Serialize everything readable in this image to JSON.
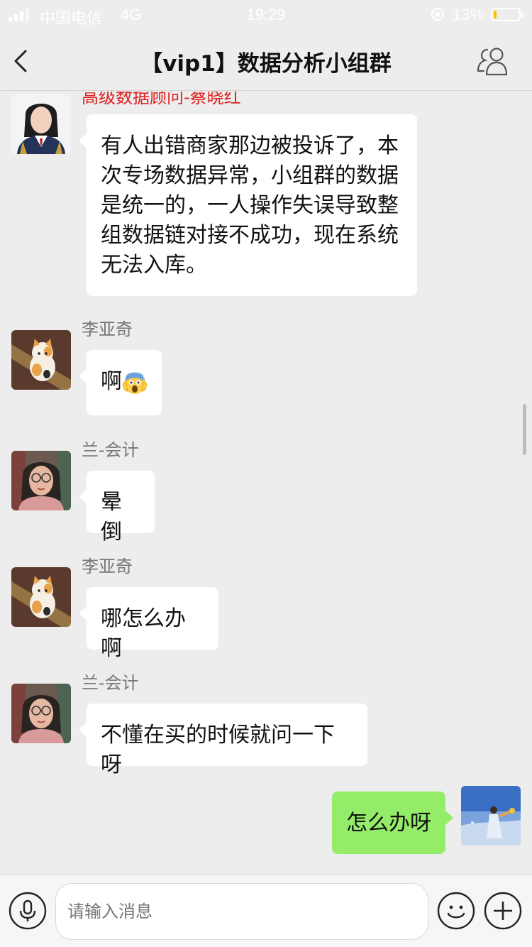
{
  "status_bar": {
    "carrier": "中国电信",
    "network": "4G",
    "time": "19:29",
    "battery_percent": "13%",
    "battery_level": 0.13
  },
  "nav": {
    "title": "【vip1】数据分析小组群",
    "icons": [
      "back-arrow-icon",
      "group-members-icon"
    ]
  },
  "messages": [
    {
      "sender": "高级数据顾问-蔡晓红",
      "sender_color": "#e02020",
      "text": "有人出错商家那边被投诉了，本\n次专场数据异常，小组群的数据\n是统一的，一人操作失误导致整\n组数据链对接不成功，现在系统\n无法入库。"
    },
    {
      "sender": "李亚奇",
      "text": "啊",
      "emoji": "screaming-face-emoji"
    },
    {
      "sender": "兰-会计",
      "text": "晕倒"
    },
    {
      "sender": "李亚奇",
      "text": "哪怎么办啊"
    },
    {
      "sender": "兰-会计",
      "text": "不懂在买的时候就问一下呀"
    },
    {
      "sender": "me",
      "text": "怎么办呀",
      "bubble_color": "#95ec69"
    }
  ],
  "input_bar": {
    "placeholder": "请输入消息",
    "icons": [
      "microphone-icon",
      "emoji-smile-icon",
      "plus-icon"
    ]
  },
  "colors": {
    "background": "#ededed",
    "my_bubble": "#95ec69",
    "other_bubble": "#ffffff",
    "sender_name": "#777777"
  }
}
